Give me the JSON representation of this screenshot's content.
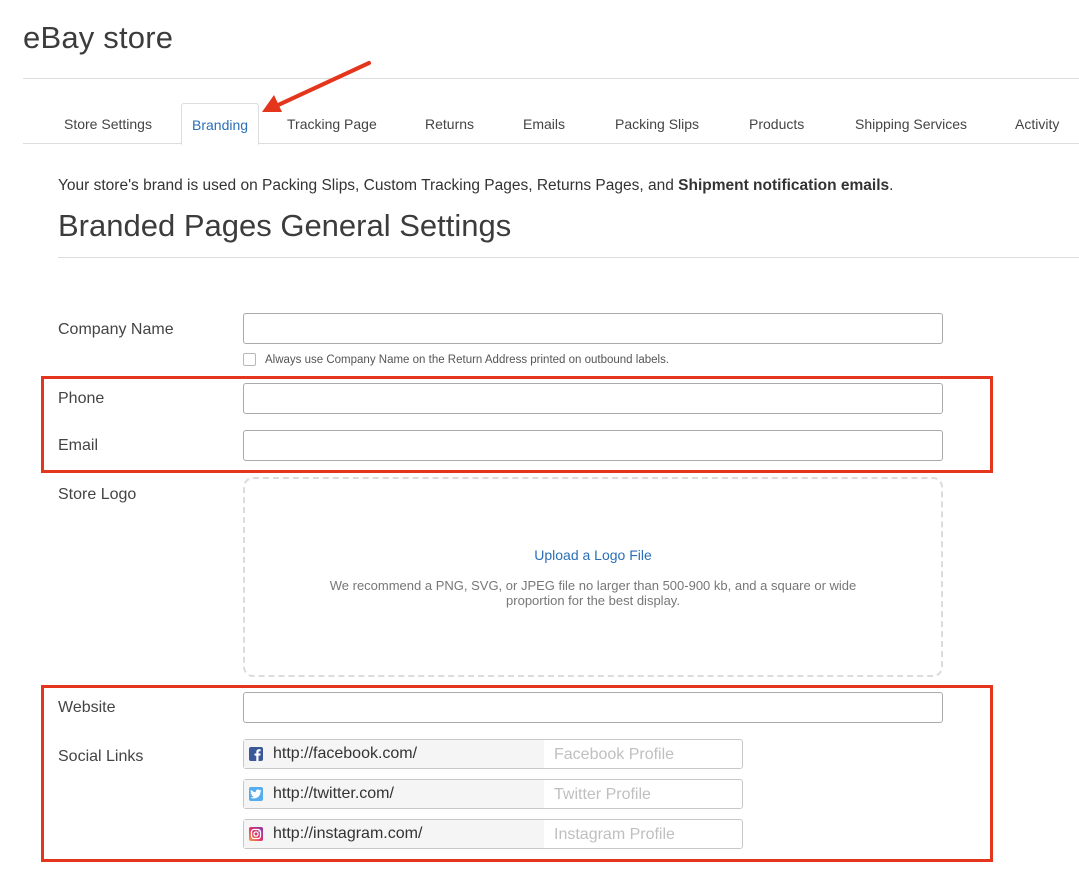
{
  "header": {
    "title": "eBay store"
  },
  "tabs": [
    {
      "label": "Store Settings"
    },
    {
      "label": "Branding"
    },
    {
      "label": "Tracking Page"
    },
    {
      "label": "Returns"
    },
    {
      "label": "Emails"
    },
    {
      "label": "Packing Slips"
    },
    {
      "label": "Products"
    },
    {
      "label": "Shipping Services"
    },
    {
      "label": "Activity"
    }
  ],
  "active_tab": "Branding",
  "intro": {
    "text": "Your store's brand is used on Packing Slips, Custom Tracking Pages, Returns Pages, and ",
    "bold": "Shipment notification emails",
    "end": "."
  },
  "section": {
    "title": "Branded Pages General Settings"
  },
  "form": {
    "company_name": {
      "label": "Company Name",
      "value": ""
    },
    "always_use_checkbox": {
      "label": "Always use Company Name on the Return Address printed on outbound labels.",
      "checked": false
    },
    "phone": {
      "label": "Phone",
      "value": ""
    },
    "email": {
      "label": "Email",
      "value": ""
    },
    "store_logo": {
      "label": "Store Logo",
      "upload_link": "Upload a Logo File",
      "hint": "We recommend a PNG, SVG, or JPEG file no larger than 500-900 kb, and a square or wide proportion for the best display."
    },
    "website": {
      "label": "Website",
      "value": ""
    },
    "social_links": {
      "label": "Social Links",
      "items": [
        {
          "icon": "facebook-icon",
          "prefix": "http://facebook.com/",
          "placeholder": "Facebook Profile",
          "color": "#3b5998"
        },
        {
          "icon": "twitter-icon",
          "prefix": "http://twitter.com/",
          "placeholder": "Twitter Profile",
          "color": "#55acee"
        },
        {
          "icon": "instagram-icon",
          "prefix": "http://instagram.com/",
          "placeholder": "Instagram Profile",
          "color": "#c13584"
        }
      ]
    }
  },
  "colors": {
    "accent": "#2a6fb7",
    "highlight": "#e4361c"
  }
}
